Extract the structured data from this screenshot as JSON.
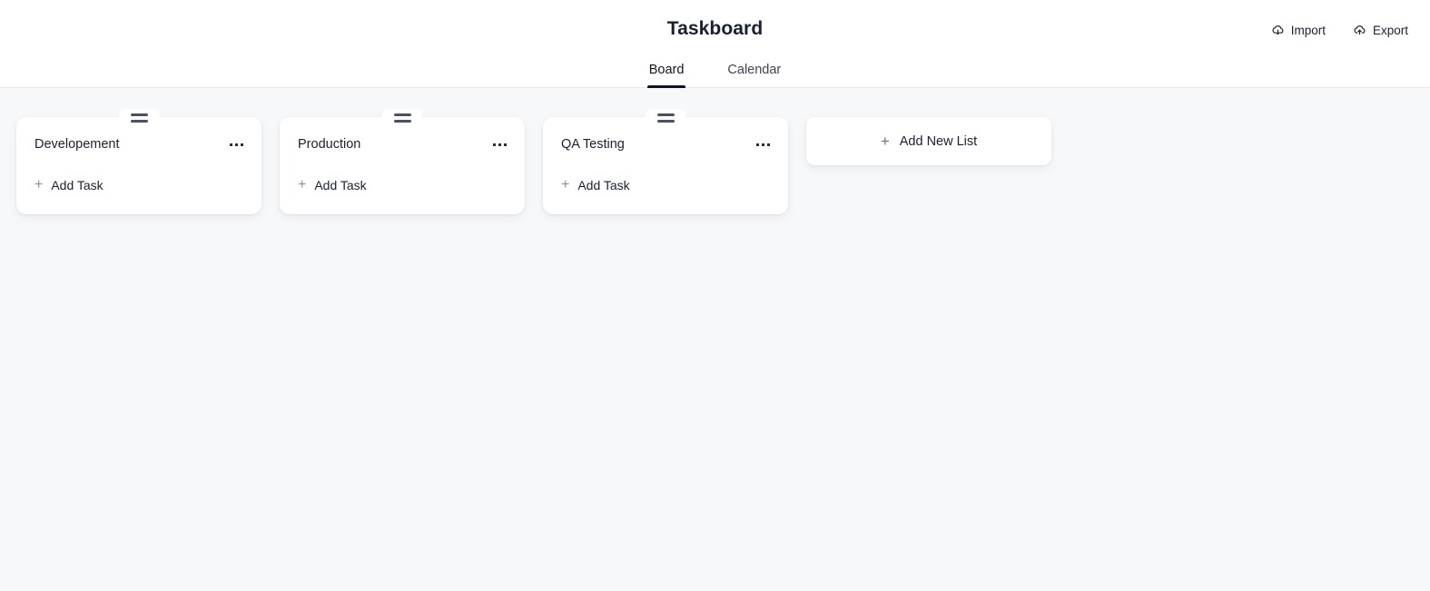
{
  "header": {
    "title": "Taskboard",
    "actions": [
      {
        "label": "Import",
        "icon": "cloud-download-icon"
      },
      {
        "label": "Export",
        "icon": "cloud-upload-icon"
      }
    ],
    "tabs": [
      {
        "label": "Board",
        "active": true
      },
      {
        "label": "Calendar",
        "active": false
      }
    ]
  },
  "board": {
    "lists": [
      {
        "title": "Developement",
        "add_task_label": "Add Task",
        "menu_icon": "ellipsis-icon",
        "handle_icon": "drag-handle-icon",
        "tasks": []
      },
      {
        "title": "Production",
        "add_task_label": "Add Task",
        "menu_icon": "ellipsis-icon",
        "handle_icon": "drag-handle-icon",
        "tasks": []
      },
      {
        "title": "QA Testing",
        "add_task_label": "Add Task",
        "menu_icon": "ellipsis-icon",
        "handle_icon": "drag-handle-icon",
        "tasks": []
      }
    ],
    "add_list_label": "Add New List",
    "add_glyph": "+"
  },
  "colors": {
    "page_background": "#f7f8fa",
    "header_background": "#ffffff",
    "card_background": "#ffffff",
    "text_primary": "#1b2030",
    "text_muted": "#8b909d",
    "active_tab_underline": "#11151f",
    "border": "#e8eaee"
  }
}
